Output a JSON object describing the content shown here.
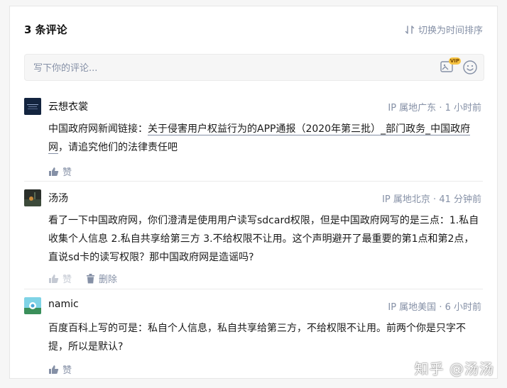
{
  "header": {
    "count_label": "3 条评论",
    "sort_label": "切换为时间排序"
  },
  "input": {
    "placeholder": "写下你的评论...",
    "vip_badge": "VIP"
  },
  "comments": [
    {
      "author": "云想衣裳",
      "ip": "IP 属地广东",
      "time": "1 小时前",
      "text_prefix": "中国政府网新闻链接：",
      "link_text": "关于侵害用户权益行为的APP通报（2020年第三批）_部门政务_中国政府网",
      "text_suffix": "，请追究他们的法律责任吧",
      "like_label": "赞"
    },
    {
      "author": "汤汤",
      "ip": "IP 属地北京",
      "time": "41 分钟前",
      "text": "看了一下中国政府网，你们澄清是使用用户读写sdcard权限，但是中国政府网写的是三点：1.私自收集个人信息 2.私自共享给第三方 3.不给权限不让用。这个声明避开了最重要的第1点和第2点，直说sd卡的读写权限？那中国政府网是造谣吗?",
      "like_label": "赞",
      "delete_label": "删除"
    },
    {
      "author": "namic",
      "ip": "IP 属地美国",
      "time": "6 小时前",
      "text": "百度百科上写的可是：私自个人信息，私自共享给第三方，不给权限不让用。前两个你是只字不提，所以是默认?",
      "like_label": "赞"
    }
  ],
  "watermark": "知乎 @汤汤",
  "colors": {
    "meta": "#8590a6",
    "text": "#1a1a1a",
    "divider": "#ebebeb"
  }
}
